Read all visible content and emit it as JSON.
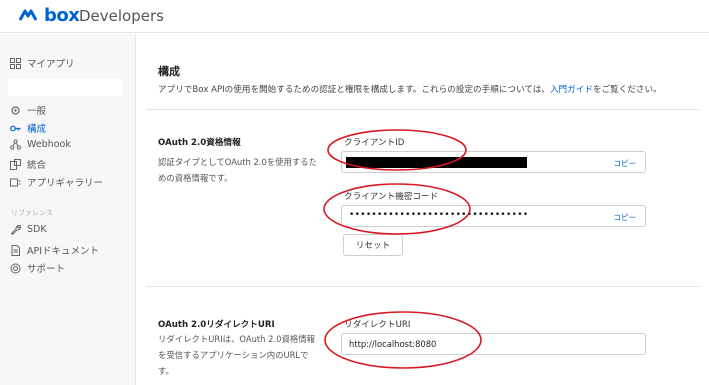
{
  "header": {
    "brand": "box",
    "product": "Developers"
  },
  "sidebar": {
    "my_apps": "マイアプリ",
    "items": [
      {
        "label": "一般",
        "icon": "gear-icon"
      },
      {
        "label": "構成",
        "icon": "key-icon",
        "active": true
      },
      {
        "label": "Webhook",
        "icon": "webhook-icon"
      },
      {
        "label": "統合",
        "icon": "integration-icon"
      },
      {
        "label": "アプリギャラリー",
        "icon": "gallery-icon"
      }
    ],
    "reference_title": "リファレンス",
    "reference_items": [
      {
        "label": "SDK",
        "icon": "wrench-icon"
      },
      {
        "label": "APIドキュメント",
        "icon": "document-icon"
      },
      {
        "label": "サポート",
        "icon": "lifebuoy-icon"
      }
    ]
  },
  "main": {
    "title": "構成",
    "description_before": "アプリでBox APIの使用を開始するための認証と権限を構成します。これらの設定の手順については、",
    "description_link": "入門ガイド",
    "description_after": "をご覧ください。",
    "oauth": {
      "title": "OAuth 2.0資格情報",
      "description": "認証タイプとしてOAuth 2.0を使用するための資格情報です。",
      "client_id_label": "クライアントID",
      "client_secret_label": "クライアント機密コード",
      "client_secret_masked": "••••••••••••••••••••••••••••••••",
      "copy_label": "コピー",
      "reset_label": "リセット"
    },
    "redirect": {
      "title": "OAuth 2.0リダイレクトURI",
      "description": "リダイレクトURIは、OAuth 2.0資格情報を受信するアプリケーション内のURLです。",
      "field_label": "リダイレクトURI",
      "value": "http://localhost:8080"
    }
  },
  "colors": {
    "brand": "#0061d5",
    "annotation": "#d71920"
  }
}
